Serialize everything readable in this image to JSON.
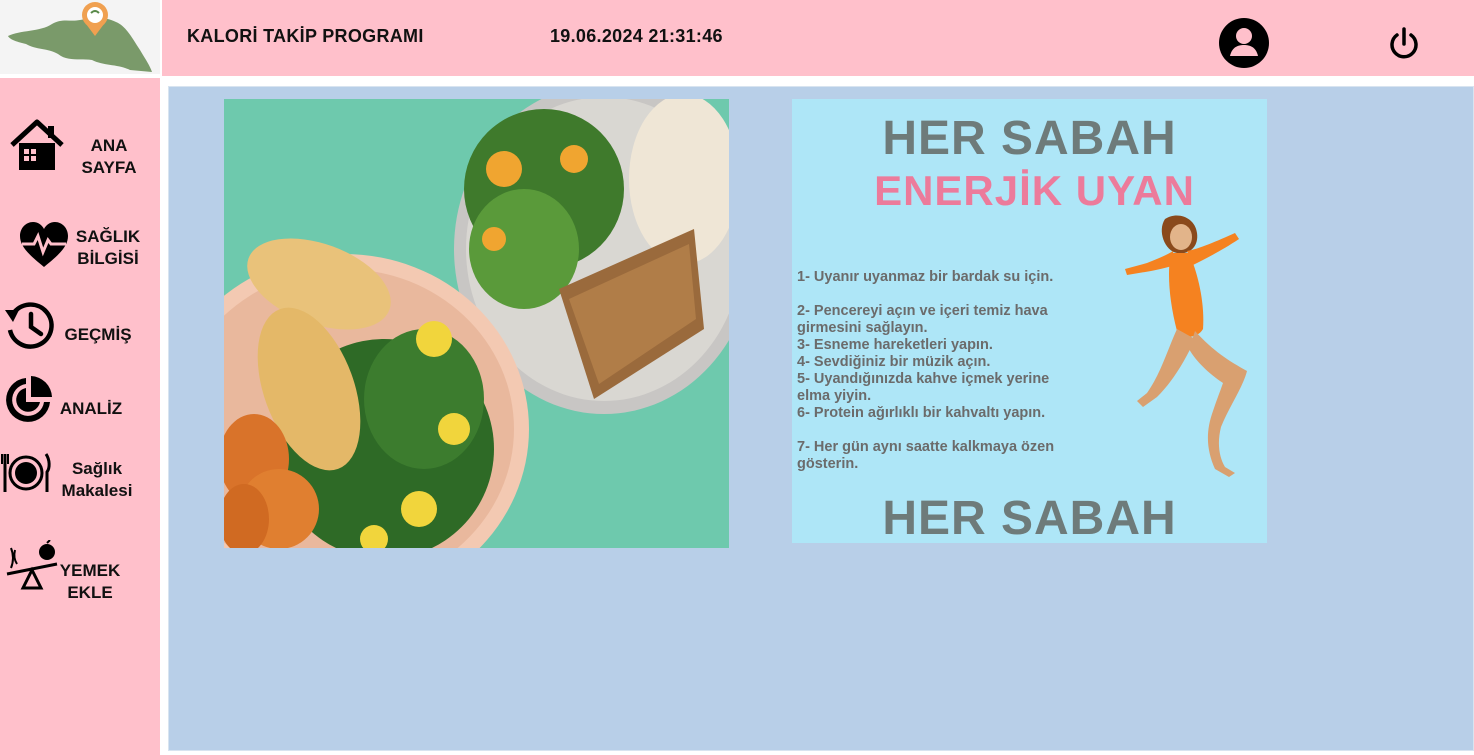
{
  "header": {
    "app_title": "KALORİ TAKİP PROGRAMI",
    "datetime": "19.06.2024 21:31:46",
    "profile_icon": "user-circle-icon",
    "power_icon": "power-icon"
  },
  "logo": {
    "icon": "map-location-logo"
  },
  "sidebar": {
    "items": [
      {
        "label": "ANA\nSAYFA",
        "icon": "home-icon"
      },
      {
        "label": "SAĞLIK\nBİLGİSİ",
        "icon": "heart-pulse-icon"
      },
      {
        "label": "GEÇMİŞ",
        "icon": "history-clock-icon"
      },
      {
        "label": "ANALİZ",
        "icon": "pie-chart-icon"
      },
      {
        "label": "Sağlık\nMakalesi",
        "icon": "plate-cutlery-icon"
      },
      {
        "label": "YEMEK\nEKLE",
        "icon": "food-scale-icon"
      }
    ]
  },
  "poster": {
    "heading": "HER SABAH",
    "subheading": "ENERJİK UYAN",
    "tips": [
      "1- Uyanır uyanmaz bir bardak su için.",
      "2- Pencereyi açın ve içeri temiz hava girmesini sağlayın.",
      "3- Esneme hareketleri yapın.",
      "4- Sevdiğiniz bir müzik açın.",
      "5- Uyandığınızda kahve içmek yerine elma yiyin.",
      "6- Protein ağırlıklı bir kahvaltı yapın.",
      "7- Her gün aynı saatte kalkmaya özen gösterin."
    ],
    "footer": "HER SABAH"
  },
  "colors": {
    "header_bg": "#ffc0cb",
    "sidebar_bg": "#ffc0cb",
    "content_bg": "#b8cfe8",
    "poster_bg": "#aee6f7",
    "poster_heading": "#6e7b7a",
    "poster_subheading": "#ec7b9b"
  }
}
